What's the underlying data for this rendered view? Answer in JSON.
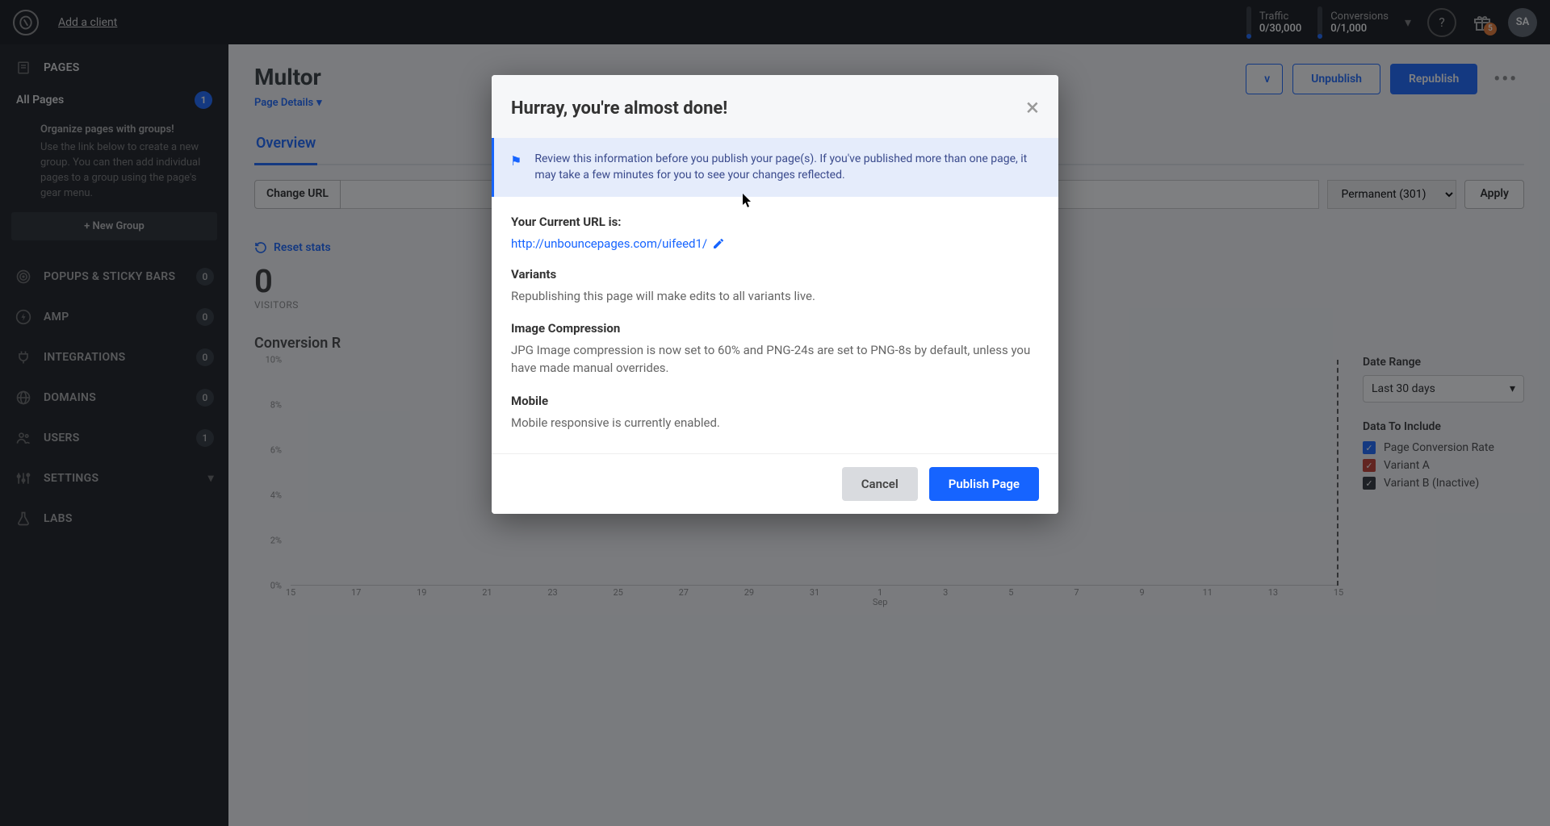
{
  "topbar": {
    "add_client": "Add a client",
    "traffic": {
      "label": "Traffic",
      "value": "0/30,000"
    },
    "conversions": {
      "label": "Conversions",
      "value": "0/1,000"
    },
    "gift_badge": "5",
    "avatar": "SA"
  },
  "sidebar": {
    "pages_label": "PAGES",
    "all_pages": {
      "label": "All Pages",
      "count": "1"
    },
    "group_info": {
      "title": "Organize pages with groups!",
      "text": "Use the link below to create a new group. You can then add individual pages to a group using the page's gear menu."
    },
    "new_group": "+ New Group",
    "items": [
      {
        "label": "POPUPS & STICKY BARS",
        "count": "0"
      },
      {
        "label": "AMP",
        "count": "0"
      },
      {
        "label": "INTEGRATIONS",
        "count": "0"
      },
      {
        "label": "DOMAINS",
        "count": "0"
      },
      {
        "label": "USERS",
        "count": "1"
      },
      {
        "label": "SETTINGS",
        "caret": true
      },
      {
        "label": "LABS"
      }
    ]
  },
  "main": {
    "page_title": "Multor",
    "page_details": "Page Details",
    "actions": {
      "unpublish": "Unpublish",
      "republish": "Republish"
    },
    "tab_overview": "Overview",
    "change_url": "Change URL",
    "redirect": "Permanent (301)",
    "apply": "Apply",
    "reset_stats": "Reset stats",
    "visitors": {
      "value": "0",
      "label": "VISITORS"
    },
    "chart_title": "Conversion R",
    "date_range_label": "Date Range",
    "date_range_value": "Last 30 days",
    "data_include_label": "Data To Include",
    "legend": [
      {
        "label": "Page Conversion Rate",
        "color": "blue"
      },
      {
        "label": "Variant A",
        "color": "red"
      },
      {
        "label": "Variant B (Inactive)",
        "color": "dark"
      }
    ]
  },
  "modal": {
    "title": "Hurray, you're almost done!",
    "banner": "Review this information before you publish your page(s). If you've published more than one page, it may take a few minutes for you to see your changes reflected.",
    "url_label": "Your Current URL is:",
    "url_value": "http://unbouncepages.com/uifeed1/",
    "variants_label": "Variants",
    "variants_text": "Republishing this page will make edits to all variants live.",
    "compression_label": "Image Compression",
    "compression_text": "JPG Image compression is now set to 60% and PNG-24s are set to PNG-8s by default, unless you have made manual overrides.",
    "mobile_label": "Mobile",
    "mobile_text": "Mobile responsive is currently enabled.",
    "cancel": "Cancel",
    "publish": "Publish Page"
  },
  "chart_data": {
    "type": "line",
    "title": "Conversion Rate",
    "x": [
      "15",
      "17",
      "19",
      "21",
      "23",
      "25",
      "27",
      "29",
      "31",
      "1",
      "3",
      "5",
      "7",
      "9",
      "11",
      "13",
      "15"
    ],
    "x_sublabel": {
      "value": "Sep",
      "at_index": 9
    },
    "ylabel": "",
    "y_ticks": [
      "10%",
      "8%",
      "6%",
      "4%",
      "2%",
      "0%"
    ],
    "ylim": [
      0,
      10
    ],
    "series": [
      {
        "name": "Page Conversion Rate",
        "values": []
      },
      {
        "name": "Variant A",
        "values": []
      },
      {
        "name": "Variant B (Inactive)",
        "values": []
      }
    ],
    "marker_at_index": 16
  }
}
